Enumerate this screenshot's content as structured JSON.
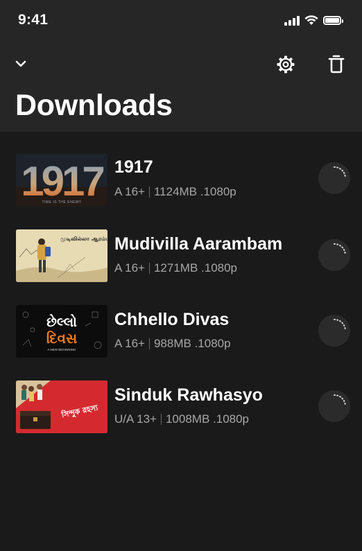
{
  "status_bar": {
    "time": "9:41"
  },
  "header": {
    "title": "Downloads"
  },
  "colors": {
    "background": "#1a1a1b",
    "header_bg": "#262627",
    "meta_text": "#a7a7a8",
    "accent_orange": "#f07a1e"
  },
  "downloads": [
    {
      "title": "1917",
      "rating": "A 16+",
      "details": "1124MB .1080p",
      "poster_text": "1917",
      "poster_tagline": "TIME IS THE ENEMY"
    },
    {
      "title": "Mudivilla Aarambam",
      "rating": "A 16+",
      "details": "1271MB .1080p",
      "poster_text": "முடிவில்லா ஆரம்பம்"
    },
    {
      "title": "Chhello Divas",
      "rating": "A 16+",
      "details": "988MB .1080p",
      "poster_text": "છેલ્લો દિવસ",
      "poster_top": "છેલ્લો",
      "poster_bottom": "દિવસ",
      "poster_tagline": "A NEW BEGINNING"
    },
    {
      "title": "Sinduk Rawhasyo",
      "rating": "U/A 13+",
      "details": "1008MB .1080p",
      "poster_text": "সিন্দুক রহস্য"
    }
  ]
}
